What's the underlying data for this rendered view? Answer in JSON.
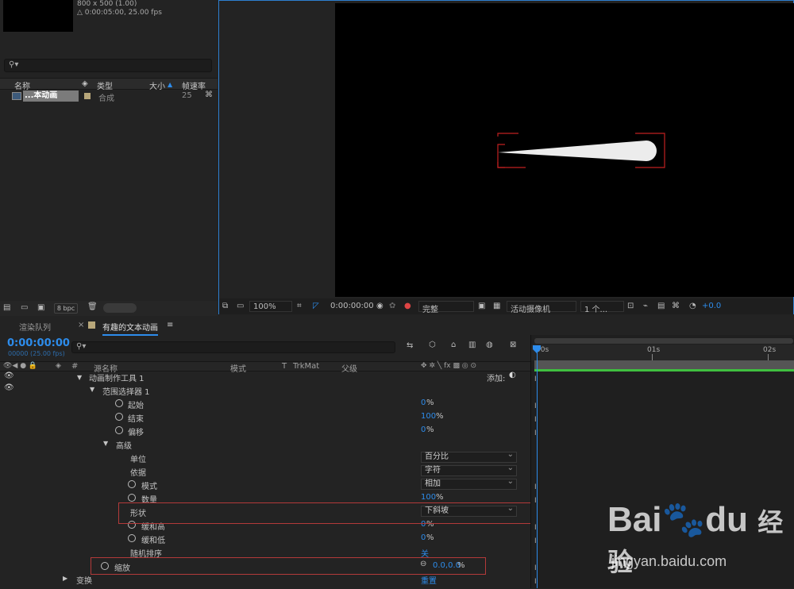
{
  "project": {
    "meta_line1": "800 x 500 (1.00)",
    "meta_line2": "△ 0:00:05:00, 25.00 fps",
    "search_placeholder": "⚲▾",
    "columns": {
      "name": "名称",
      "type": "类型",
      "size": "大小",
      "fps": "帧速率"
    },
    "item": {
      "name": "...本动画",
      "type": "合成",
      "fps": "25"
    },
    "bpc": "8 bpc"
  },
  "viewer": {
    "zoom": "100%",
    "timecode": "0:00:00:00",
    "quality": "完整",
    "camera": "活动摄像机",
    "views": "1 个...",
    "exposure": "+0.0"
  },
  "timeline": {
    "tab_render": "渲染队列",
    "tab_comp": "有趣的文本动画",
    "timecode": "0:00:00:00",
    "frame_info": "00000 (25.00 fps)",
    "search_placeholder": "⚲▾",
    "columns": {
      "num": "#",
      "source": "源名称",
      "mode": "模式",
      "t": "T",
      "trkmat": "TrkMat",
      "parent": "父级"
    },
    "ruler": {
      "t0": "00s",
      "t1": "01s",
      "t2": "02s"
    },
    "add_label": "添加:",
    "rows": [
      {
        "label": "动画制作工具 1",
        "value": ""
      },
      {
        "label": "范围选择器 1",
        "value": ""
      },
      {
        "label": "起始",
        "value": "0",
        "unit": "%"
      },
      {
        "label": "结束",
        "value": "100",
        "unit": "%"
      },
      {
        "label": "偏移",
        "value": "0",
        "unit": "%"
      },
      {
        "label": "高级",
        "value": ""
      },
      {
        "label": "单位",
        "select": "百分比"
      },
      {
        "label": "依据",
        "select": "字符"
      },
      {
        "label": "模式",
        "select": "相加"
      },
      {
        "label": "数量",
        "value": "100",
        "unit": "%"
      },
      {
        "label": "形状",
        "select": "下斜坡"
      },
      {
        "label": "缓和高",
        "value": "0",
        "unit": "%"
      },
      {
        "label": "缓和低",
        "value": "0",
        "unit": "%"
      },
      {
        "label": "随机排序",
        "value": "关"
      },
      {
        "label": "缩放",
        "value": "0.0,0.0",
        "unit": "%"
      },
      {
        "label": "变换",
        "value": "重置"
      }
    ]
  },
  "colors": {
    "accent": "#2d8ceb",
    "highlight": "#b33a3a",
    "green": "#3fbf3f"
  }
}
